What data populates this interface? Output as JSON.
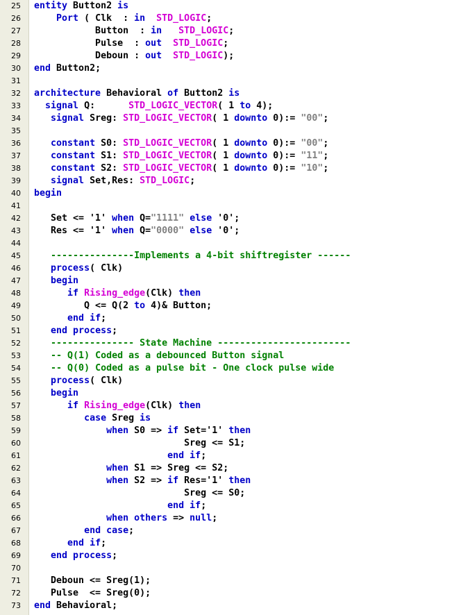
{
  "editor": {
    "colors": {
      "gutter_background": "#eeeee2",
      "default_text": "#000000",
      "keyword": "#0000c8",
      "type": "#d400d4",
      "string": "#808080",
      "comment": "#008000"
    },
    "lines": [
      {
        "number": "25",
        "tokens": [
          [
            "keyword",
            "entity"
          ],
          [
            "default",
            " Button2 "
          ],
          [
            "keyword",
            "is"
          ]
        ]
      },
      {
        "number": "26",
        "tokens": [
          [
            "default",
            "    "
          ],
          [
            "keyword",
            "Port"
          ],
          [
            "default",
            " ( Clk  : "
          ],
          [
            "keyword",
            "in"
          ],
          [
            "default",
            "  "
          ],
          [
            "type",
            "STD_LOGIC"
          ],
          [
            "default",
            ";"
          ]
        ]
      },
      {
        "number": "27",
        "tokens": [
          [
            "default",
            "           Button  : "
          ],
          [
            "keyword",
            "in"
          ],
          [
            "default",
            "   "
          ],
          [
            "type",
            "STD_LOGIC"
          ],
          [
            "default",
            ";"
          ]
        ]
      },
      {
        "number": "28",
        "tokens": [
          [
            "default",
            "           Pulse  : "
          ],
          [
            "keyword",
            "out"
          ],
          [
            "default",
            "  "
          ],
          [
            "type",
            "STD_LOGIC"
          ],
          [
            "default",
            ";"
          ]
        ]
      },
      {
        "number": "29",
        "tokens": [
          [
            "default",
            "           Deboun : "
          ],
          [
            "keyword",
            "out"
          ],
          [
            "default",
            "  "
          ],
          [
            "type",
            "STD_LOGIC"
          ],
          [
            "default",
            ");"
          ]
        ]
      },
      {
        "number": "30",
        "tokens": [
          [
            "keyword",
            "end"
          ],
          [
            "default",
            " Button2;"
          ]
        ]
      },
      {
        "number": "31",
        "tokens": []
      },
      {
        "number": "32",
        "tokens": [
          [
            "keyword",
            "architecture"
          ],
          [
            "default",
            " Behavioral "
          ],
          [
            "keyword",
            "of"
          ],
          [
            "default",
            " Button2 "
          ],
          [
            "keyword",
            "is"
          ]
        ]
      },
      {
        "number": "33",
        "tokens": [
          [
            "default",
            "  "
          ],
          [
            "keyword",
            "signal"
          ],
          [
            "default",
            " Q:      "
          ],
          [
            "type",
            "STD_LOGIC_VECTOR"
          ],
          [
            "default",
            "( 1 "
          ],
          [
            "keyword",
            "to"
          ],
          [
            "default",
            " 4);"
          ]
        ]
      },
      {
        "number": "34",
        "tokens": [
          [
            "default",
            "   "
          ],
          [
            "keyword",
            "signal"
          ],
          [
            "default",
            " Sreg: "
          ],
          [
            "type",
            "STD_LOGIC_VECTOR"
          ],
          [
            "default",
            "( 1 "
          ],
          [
            "keyword",
            "downto"
          ],
          [
            "default",
            " 0):= "
          ],
          [
            "string",
            "\"00\""
          ],
          [
            "default",
            ";"
          ]
        ]
      },
      {
        "number": "35",
        "tokens": []
      },
      {
        "number": "36",
        "tokens": [
          [
            "default",
            "   "
          ],
          [
            "keyword",
            "constant"
          ],
          [
            "default",
            " S0: "
          ],
          [
            "type",
            "STD_LOGIC_VECTOR"
          ],
          [
            "default",
            "( 1 "
          ],
          [
            "keyword",
            "downto"
          ],
          [
            "default",
            " 0):= "
          ],
          [
            "string",
            "\"00\""
          ],
          [
            "default",
            ";"
          ]
        ]
      },
      {
        "number": "37",
        "tokens": [
          [
            "default",
            "   "
          ],
          [
            "keyword",
            "constant"
          ],
          [
            "default",
            " S1: "
          ],
          [
            "type",
            "STD_LOGIC_VECTOR"
          ],
          [
            "default",
            "( 1 "
          ],
          [
            "keyword",
            "downto"
          ],
          [
            "default",
            " 0):= "
          ],
          [
            "string",
            "\"11\""
          ],
          [
            "default",
            ";"
          ]
        ]
      },
      {
        "number": "38",
        "tokens": [
          [
            "default",
            "   "
          ],
          [
            "keyword",
            "constant"
          ],
          [
            "default",
            " S2: "
          ],
          [
            "type",
            "STD_LOGIC_VECTOR"
          ],
          [
            "default",
            "( 1 "
          ],
          [
            "keyword",
            "downto"
          ],
          [
            "default",
            " 0):= "
          ],
          [
            "string",
            "\"10\""
          ],
          [
            "default",
            ";"
          ]
        ]
      },
      {
        "number": "39",
        "tokens": [
          [
            "default",
            "   "
          ],
          [
            "keyword",
            "signal"
          ],
          [
            "default",
            " Set,Res: "
          ],
          [
            "type",
            "STD_LOGIC"
          ],
          [
            "default",
            ";"
          ]
        ]
      },
      {
        "number": "40",
        "tokens": [
          [
            "keyword",
            "begin"
          ]
        ]
      },
      {
        "number": "41",
        "tokens": []
      },
      {
        "number": "42",
        "tokens": [
          [
            "default",
            "   Set <= '1' "
          ],
          [
            "keyword",
            "when"
          ],
          [
            "default",
            " Q="
          ],
          [
            "string",
            "\"1111\""
          ],
          [
            "default",
            " "
          ],
          [
            "keyword",
            "else"
          ],
          [
            "default",
            " '0';"
          ]
        ]
      },
      {
        "number": "43",
        "tokens": [
          [
            "default",
            "   Res <= '1' "
          ],
          [
            "keyword",
            "when"
          ],
          [
            "default",
            " Q="
          ],
          [
            "string",
            "\"0000\""
          ],
          [
            "default",
            " "
          ],
          [
            "keyword",
            "else"
          ],
          [
            "default",
            " '0';"
          ]
        ]
      },
      {
        "number": "44",
        "tokens": []
      },
      {
        "number": "45",
        "tokens": [
          [
            "default",
            "   "
          ],
          [
            "comment",
            "---------------Implements a 4-bit shiftregister ------"
          ]
        ]
      },
      {
        "number": "46",
        "tokens": [
          [
            "default",
            "   "
          ],
          [
            "keyword",
            "process"
          ],
          [
            "default",
            "( Clk)"
          ]
        ]
      },
      {
        "number": "47",
        "tokens": [
          [
            "default",
            "   "
          ],
          [
            "keyword",
            "begin"
          ]
        ]
      },
      {
        "number": "48",
        "tokens": [
          [
            "default",
            "      "
          ],
          [
            "keyword",
            "if"
          ],
          [
            "default",
            " "
          ],
          [
            "type",
            "Rising_edge"
          ],
          [
            "default",
            "(Clk) "
          ],
          [
            "keyword",
            "then"
          ]
        ]
      },
      {
        "number": "49",
        "tokens": [
          [
            "default",
            "         Q <= Q(2 "
          ],
          [
            "keyword",
            "to"
          ],
          [
            "default",
            " 4)& Button;"
          ]
        ]
      },
      {
        "number": "50",
        "tokens": [
          [
            "default",
            "      "
          ],
          [
            "keyword",
            "end if"
          ],
          [
            "default",
            ";"
          ]
        ]
      },
      {
        "number": "51",
        "tokens": [
          [
            "default",
            "   "
          ],
          [
            "keyword",
            "end process"
          ],
          [
            "default",
            ";"
          ]
        ]
      },
      {
        "number": "52",
        "tokens": [
          [
            "default",
            "   "
          ],
          [
            "comment",
            "--------------- State Machine ------------------------"
          ]
        ]
      },
      {
        "number": "53",
        "tokens": [
          [
            "default",
            "   "
          ],
          [
            "comment",
            "-- Q(1) Coded as a debounced Button signal"
          ]
        ]
      },
      {
        "number": "54",
        "tokens": [
          [
            "default",
            "   "
          ],
          [
            "comment",
            "-- Q(0) Coded as a pulse bit - One clock pulse wide"
          ]
        ]
      },
      {
        "number": "55",
        "tokens": [
          [
            "default",
            "   "
          ],
          [
            "keyword",
            "process"
          ],
          [
            "default",
            "( Clk)"
          ]
        ]
      },
      {
        "number": "56",
        "tokens": [
          [
            "default",
            "   "
          ],
          [
            "keyword",
            "begin"
          ]
        ]
      },
      {
        "number": "57",
        "tokens": [
          [
            "default",
            "      "
          ],
          [
            "keyword",
            "if"
          ],
          [
            "default",
            " "
          ],
          [
            "type",
            "Rising_edge"
          ],
          [
            "default",
            "(Clk) "
          ],
          [
            "keyword",
            "then"
          ]
        ]
      },
      {
        "number": "58",
        "tokens": [
          [
            "default",
            "         "
          ],
          [
            "keyword",
            "case"
          ],
          [
            "default",
            " Sreg "
          ],
          [
            "keyword",
            "is"
          ]
        ]
      },
      {
        "number": "59",
        "tokens": [
          [
            "default",
            "             "
          ],
          [
            "keyword",
            "when"
          ],
          [
            "default",
            " S0 => "
          ],
          [
            "keyword",
            "if"
          ],
          [
            "default",
            " Set='1' "
          ],
          [
            "keyword",
            "then"
          ]
        ]
      },
      {
        "number": "60",
        "tokens": [
          [
            "default",
            "                           Sreg <= S1;"
          ]
        ]
      },
      {
        "number": "61",
        "tokens": [
          [
            "default",
            "                        "
          ],
          [
            "keyword",
            "end if"
          ],
          [
            "default",
            ";"
          ]
        ]
      },
      {
        "number": "62",
        "tokens": [
          [
            "default",
            "             "
          ],
          [
            "keyword",
            "when"
          ],
          [
            "default",
            " S1 => Sreg <= S2;"
          ]
        ]
      },
      {
        "number": "63",
        "tokens": [
          [
            "default",
            "             "
          ],
          [
            "keyword",
            "when"
          ],
          [
            "default",
            " S2 => "
          ],
          [
            "keyword",
            "if"
          ],
          [
            "default",
            " Res='1' "
          ],
          [
            "keyword",
            "then"
          ]
        ]
      },
      {
        "number": "64",
        "tokens": [
          [
            "default",
            "                           Sreg <= S0;"
          ]
        ]
      },
      {
        "number": "65",
        "tokens": [
          [
            "default",
            "                        "
          ],
          [
            "keyword",
            "end if"
          ],
          [
            "default",
            ";"
          ]
        ]
      },
      {
        "number": "66",
        "tokens": [
          [
            "default",
            "             "
          ],
          [
            "keyword",
            "when others"
          ],
          [
            "default",
            " => "
          ],
          [
            "keyword",
            "null"
          ],
          [
            "default",
            ";"
          ]
        ]
      },
      {
        "number": "67",
        "tokens": [
          [
            "default",
            "         "
          ],
          [
            "keyword",
            "end case"
          ],
          [
            "default",
            ";"
          ]
        ]
      },
      {
        "number": "68",
        "tokens": [
          [
            "default",
            "      "
          ],
          [
            "keyword",
            "end if"
          ],
          [
            "default",
            ";"
          ]
        ]
      },
      {
        "number": "69",
        "tokens": [
          [
            "default",
            "   "
          ],
          [
            "keyword",
            "end process"
          ],
          [
            "default",
            ";"
          ]
        ]
      },
      {
        "number": "70",
        "tokens": []
      },
      {
        "number": "71",
        "tokens": [
          [
            "default",
            "   Deboun <= Sreg(1);"
          ]
        ]
      },
      {
        "number": "72",
        "tokens": [
          [
            "default",
            "   Pulse  <= Sreg(0);"
          ]
        ]
      },
      {
        "number": "73",
        "tokens": [
          [
            "keyword",
            "end"
          ],
          [
            "default",
            " Behavioral;"
          ]
        ]
      }
    ]
  }
}
